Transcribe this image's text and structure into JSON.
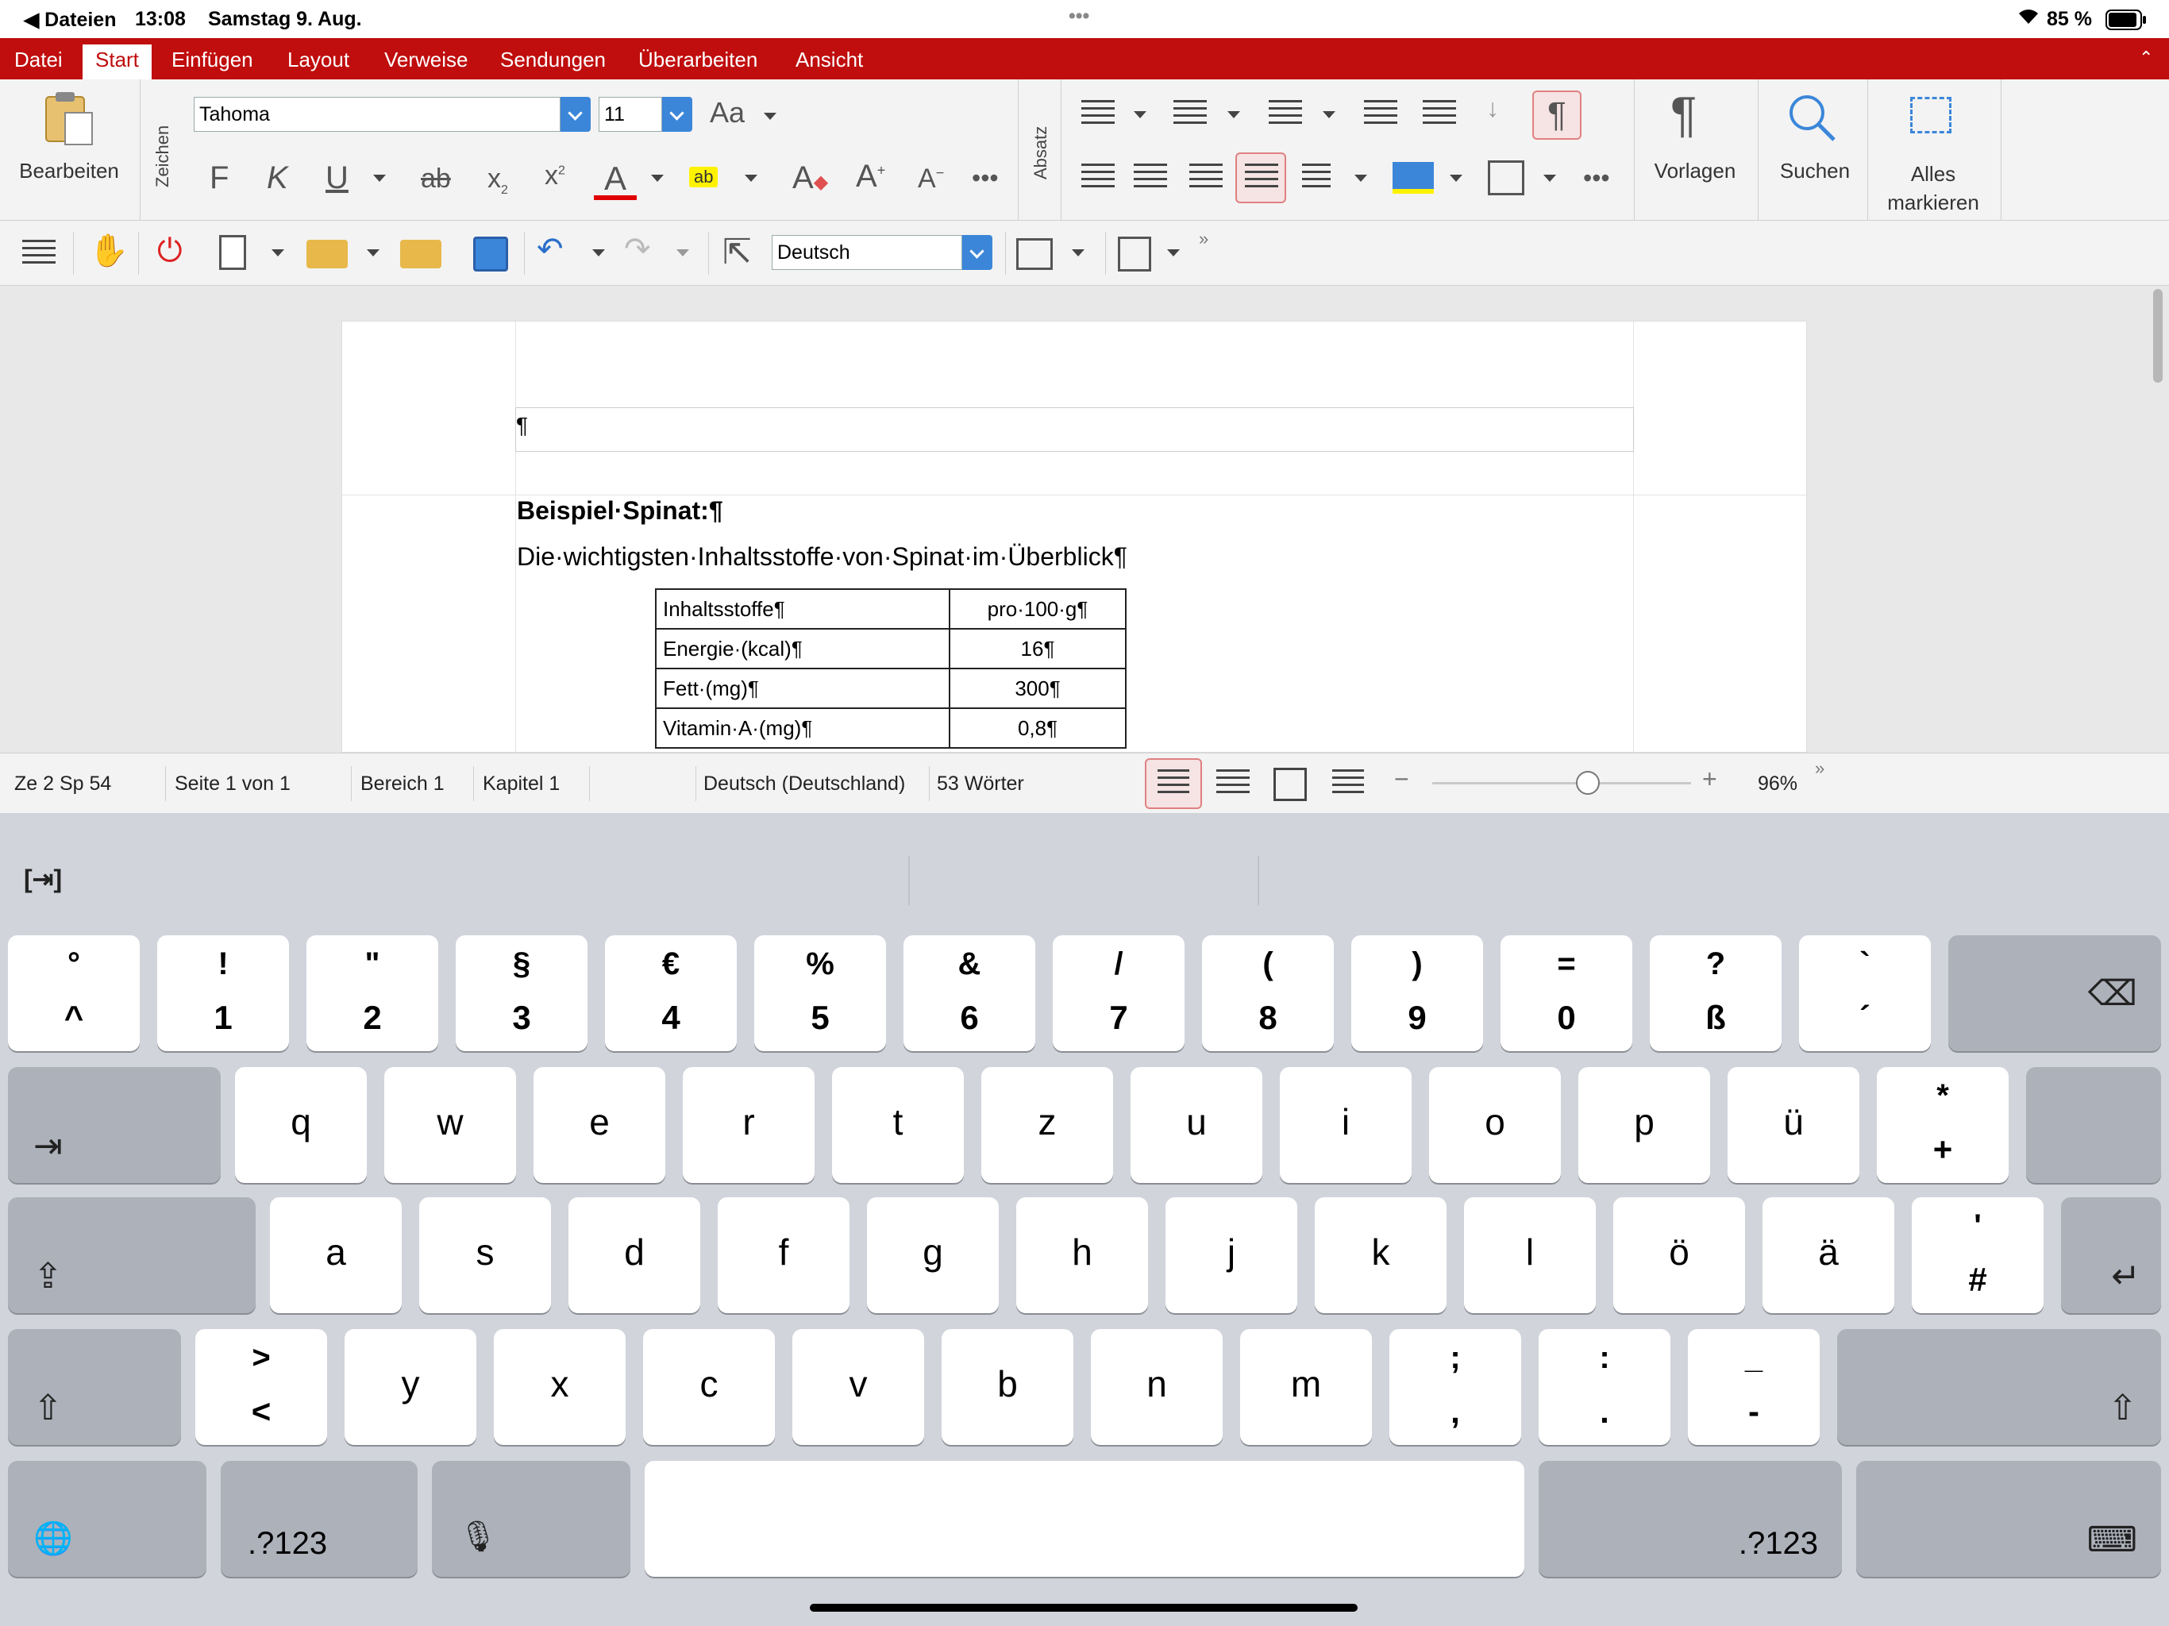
{
  "status_bar": {
    "back_app": "◀ Dateien",
    "time": "13:08",
    "date": "Samstag 9. Aug.",
    "dots": "•••",
    "battery": "85 %"
  },
  "menu": {
    "tabs": [
      "Datei",
      "Start",
      "Einfügen",
      "Layout",
      "Verweise",
      "Sendungen",
      "Überarbeiten",
      "Ansicht"
    ],
    "active": "Start"
  },
  "ribbon": {
    "edit_label": "Bearbeiten",
    "zeichen_label": "Zeichen",
    "font_name": "Tahoma",
    "font_size": "11",
    "aa_label": "Aa",
    "bold": "F",
    "italic": "K",
    "underline": "U",
    "strike": "ab",
    "highlight": "ab",
    "absatz_label": "Absatz",
    "pilcrow": "¶",
    "vorlagen_label": "Vorlagen",
    "suchen_label": "Suchen",
    "alles_label_1": "Alles",
    "alles_label_2": "markieren"
  },
  "toolbar": {
    "language": "Deutsch"
  },
  "document": {
    "header_pilcrow": "¶",
    "heading": "Beispiel·Spinat:¶",
    "subheading": "Die·wichtigsten·Inhaltsstoffe·von·Spinat·im·Überblick¶",
    "table": [
      [
        "Inhaltsstoffe¶",
        "pro·100·g¶"
      ],
      [
        "Energie·(kcal)¶",
        "16¶"
      ],
      [
        "Fett·(mg)¶",
        "300¶"
      ],
      [
        "Vitamin·A·(mg)¶",
        "0,8¶"
      ]
    ]
  },
  "statusline": {
    "position": "Ze 2 Sp 54",
    "page": "Seite 1 von 1",
    "section": "Bereich 1",
    "chapter": "Kapitel 1",
    "language": "Deutsch (Deutschland)",
    "words": "53 Wörter",
    "zoom": "96%",
    "zoom_level": 0.6
  },
  "keyboard": {
    "tab_hint": "[⇥]",
    "row1": [
      [
        "°",
        "^"
      ],
      [
        "!",
        "1"
      ],
      [
        "\"",
        "2"
      ],
      [
        "§",
        "3"
      ],
      [
        "€",
        "4"
      ],
      [
        "%",
        "5"
      ],
      [
        "&",
        "6"
      ],
      [
        "/",
        "7"
      ],
      [
        "(",
        "8"
      ],
      [
        ")",
        "9"
      ],
      [
        "=",
        "0"
      ],
      [
        "?",
        "ß"
      ],
      [
        "`",
        "´"
      ]
    ],
    "row2": [
      "q",
      "w",
      "e",
      "r",
      "t",
      "z",
      "u",
      "i",
      "o",
      "p",
      "ü"
    ],
    "row2_last": [
      "*",
      "+"
    ],
    "row3": [
      "a",
      "s",
      "d",
      "f",
      "g",
      "h",
      "j",
      "k",
      "l",
      "ö",
      "ä"
    ],
    "row3_last": [
      "'",
      "#"
    ],
    "row4": [
      [
        ">",
        "<"
      ],
      [
        "y"
      ],
      [
        "x"
      ],
      [
        "c"
      ],
      [
        "v"
      ],
      [
        "b"
      ],
      [
        "n"
      ],
      [
        "m"
      ],
      [
        ";",
        ","
      ],
      [
        ":",
        "."
      ],
      [
        "_",
        "-"
      ]
    ],
    "numbers_label": ".?123"
  }
}
